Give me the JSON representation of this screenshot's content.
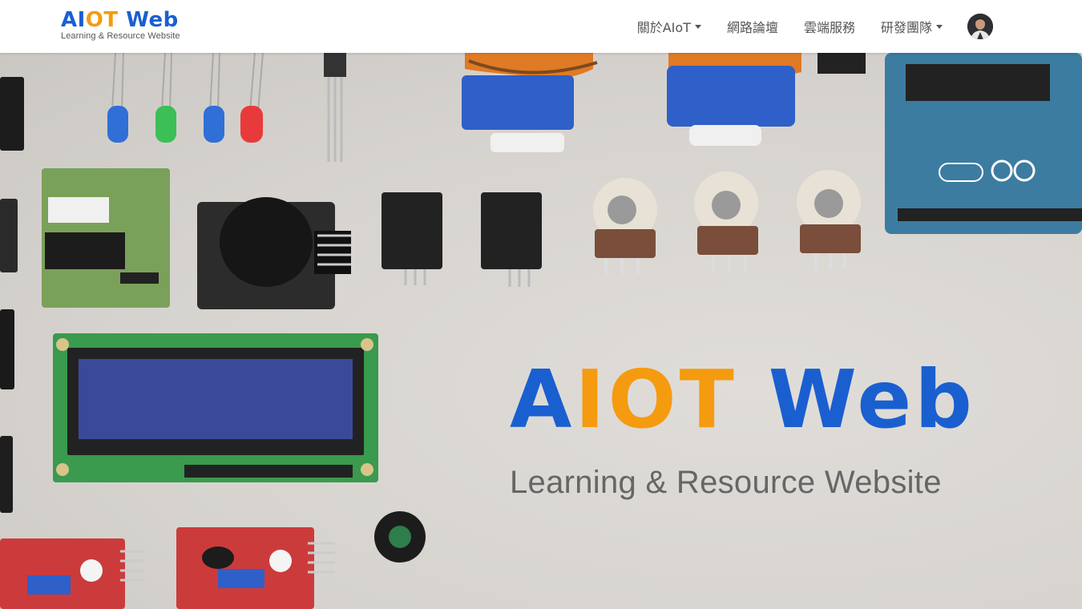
{
  "brand": {
    "title_part1": "AI",
    "title_part2": "OT",
    "title_part3": " Web",
    "subtitle": "Learning & Resource Website"
  },
  "nav": {
    "items": [
      {
        "label": "關於AIoT",
        "dropdown": true
      },
      {
        "label": "網路論壇",
        "dropdown": false
      },
      {
        "label": "雲端服務",
        "dropdown": false
      },
      {
        "label": "研發團隊",
        "dropdown": true
      }
    ],
    "avatar": "user-avatar"
  },
  "hero": {
    "title_part1": "A",
    "title_part2": "IOT",
    "title_part3": " Web",
    "subtitle": "Learning & Resource  Website",
    "image": "electronics-components-photo"
  },
  "colors": {
    "brand_blue": "#1a5fd0",
    "brand_orange": "#f59b10",
    "nav_text": "#555555",
    "navbar_bg": "#ffffff"
  }
}
